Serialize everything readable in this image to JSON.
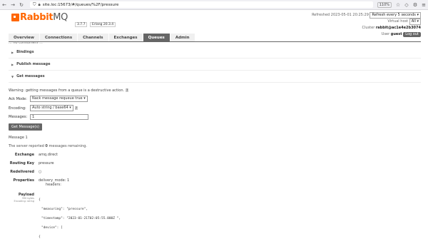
{
  "browser": {
    "url": "site.loc:15673/#/queues/%2F/pressure",
    "zoom": "110%"
  },
  "logo": {
    "main": "Rabbit",
    "suffix": "MQ"
  },
  "version": {
    "rabbitmq": "3.7.7",
    "erlang": "Erlang 20.3.4"
  },
  "status": {
    "refreshed": "Refreshed 2023-05-01 20:25:29",
    "refresh_option": "Refresh every 5 seconds",
    "virtual_host_label": "Virtual host",
    "virtual_host": "All",
    "cluster_label": "Cluster",
    "cluster": "rabbit@ac1e4e2b3074",
    "user_label": "User",
    "user": "guest",
    "logout": "Log out"
  },
  "tabs": [
    {
      "label": "Overview"
    },
    {
      "label": "Connections"
    },
    {
      "label": "Channels"
    },
    {
      "label": "Exchanges"
    },
    {
      "label": "Queues",
      "active": true
    },
    {
      "label": "Admin"
    }
  ],
  "cut_text": "... no consumers ...",
  "sections": {
    "bindings": "Bindings",
    "publish": "Publish message",
    "get": "Get messages"
  },
  "get": {
    "warning": "Warning: getting messages from a queue is a destructive action.",
    "help": "?",
    "ack_label": "Ack Mode:",
    "ack_value": "Nack message requeue true",
    "encoding_label": "Encoding:",
    "encoding_value": "Auto string / base64",
    "messages_label": "Messages:",
    "messages_value": "1",
    "button": "Get Message(s)"
  },
  "message": {
    "title": "Message 1",
    "info_prefix": "The server reported",
    "remaining": "0",
    "info_suffix": "messages remaining.",
    "exchange_label": "Exchange",
    "exchange": "amq.direct",
    "routing_key_label": "Routing Key",
    "routing_key": "pressure",
    "redelivered_label": "Redelivered",
    "redelivered": "○",
    "properties_label": "Properties",
    "delivery_mode_label": "delivery_mode:",
    "delivery_mode": "1",
    "headers_label": "headers:",
    "payload_label": "Payload",
    "payload_size": "390 bytes",
    "payload_encoding": "Encoding: string",
    "payload_lines": [
      "{",
      "\"measuring\": \"pressure\",",
      "\"timestamp\": \"2023-01-21T02:05:55.000Z \",",
      "\"device\": [",
      "{"
    ]
  }
}
